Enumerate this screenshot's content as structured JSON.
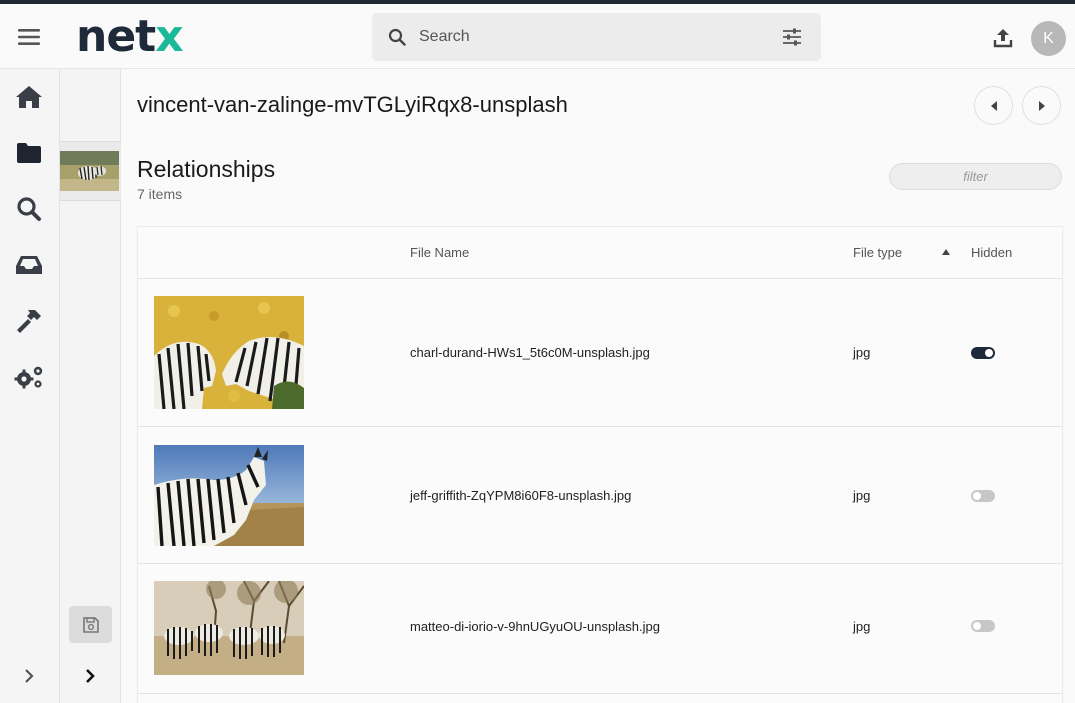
{
  "header": {
    "logo_prefix": "net",
    "logo_suffix": "x",
    "search_placeholder": "Search",
    "avatar_initial": "K"
  },
  "colors": {
    "brand_dark": "#1e2a3a",
    "brand_accent": "#1bb99a"
  },
  "sidebar": {
    "items": [
      {
        "icon": "home-icon"
      },
      {
        "icon": "folder-icon"
      },
      {
        "icon": "search-icon"
      },
      {
        "icon": "inbox-icon"
      },
      {
        "icon": "hammer-icon"
      },
      {
        "icon": "gears-icon"
      }
    ]
  },
  "asset": {
    "title": "vincent-van-zalinge-mvTGLyiRqx8-unsplash"
  },
  "relationships": {
    "title": "Relationships",
    "count_label": "7 items",
    "filter_placeholder": "filter",
    "columns": {
      "file_name": "File Name",
      "file_type": "File type",
      "hidden": "Hidden"
    },
    "rows": [
      {
        "file_name": "charl-durand-HWs1_5t6c0M-unsplash.jpg",
        "file_type": "jpg",
        "hidden": true
      },
      {
        "file_name": "jeff-griffith-ZqYPM8i60F8-unsplash.jpg",
        "file_type": "jpg",
        "hidden": false
      },
      {
        "file_name": "matteo-di-iorio-v-9hnUGyuOU-unsplash.jpg",
        "file_type": "jpg",
        "hidden": false
      }
    ]
  }
}
